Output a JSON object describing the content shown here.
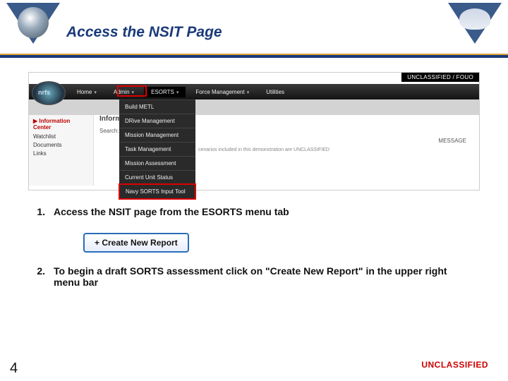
{
  "header": {
    "title": "Access the NSIT Page"
  },
  "screenshot": {
    "classification": "UNCLASSIFIED / FOUO",
    "brand": "nrfs",
    "nav": [
      "Home",
      "Admin",
      "ESORTS",
      "Force Management",
      "Utilities"
    ],
    "nav_active_index": 2,
    "dropdown": [
      "Build METL",
      "DRive Management",
      "Mission Management",
      "Task Management",
      "Mission Assessment",
      "Current Unit Status",
      "Navy SORTS Input Tool"
    ],
    "sidebar": {
      "head": "▶ Information Center",
      "items": [
        "Watchlist",
        "Documents",
        "Links"
      ]
    },
    "content_heading": "Informat",
    "search_label": "Search:",
    "message_label": "MESSAGE",
    "message_body": "cenarios included in this demonstration are UNCLASSIFIED"
  },
  "steps": {
    "s1_num": "1.",
    "s1_text": "Access the NSIT page from the ESORTS menu tab",
    "s2_num": "2.",
    "s2_text": "To begin a draft SORTS assessment click on \"Create New Report\" in the upper right menu bar"
  },
  "button": {
    "label": "Create New Report"
  },
  "footer": {
    "classification": "UNCLASSIFIED",
    "slide_number": "4"
  }
}
